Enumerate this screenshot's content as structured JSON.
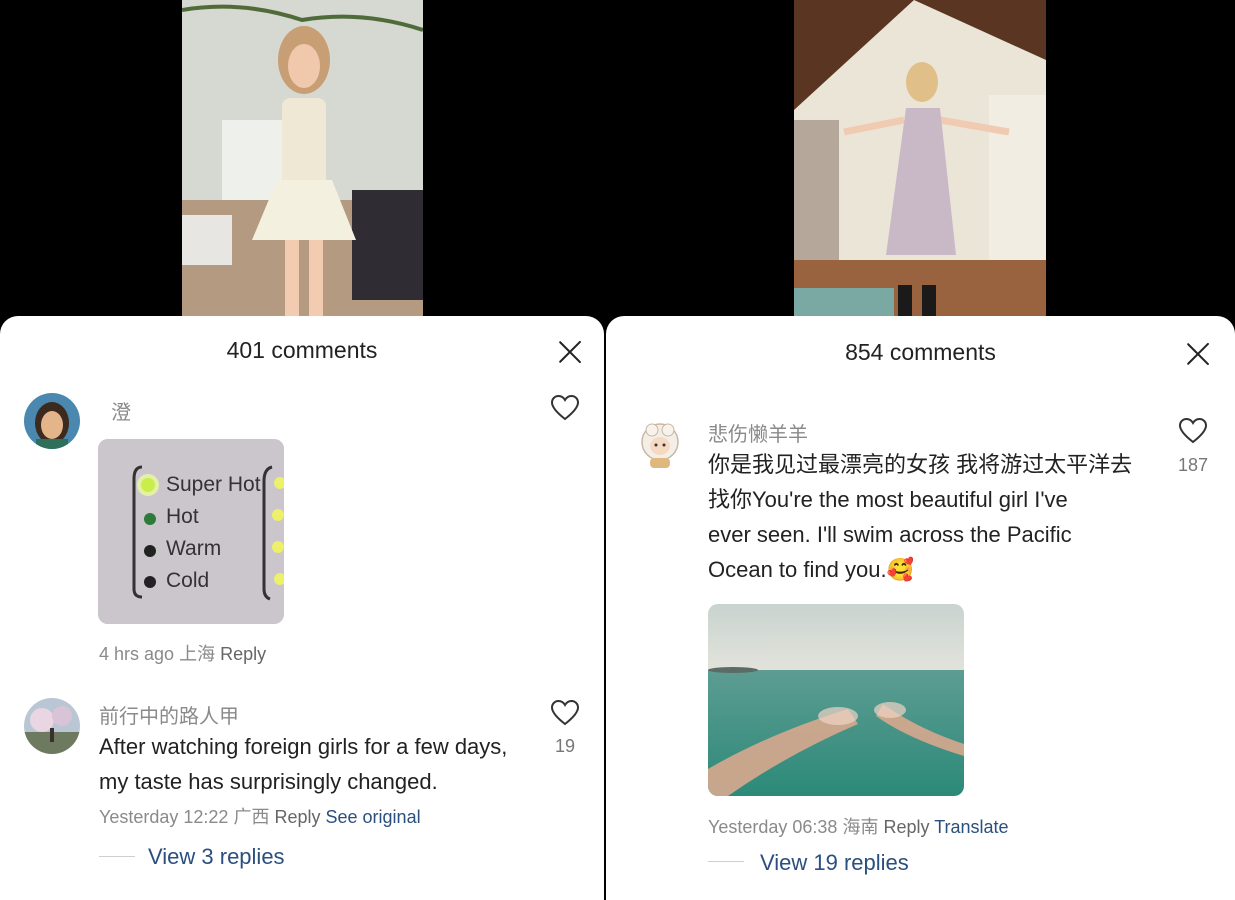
{
  "left": {
    "title": "401 comments",
    "comments": [
      {
        "username": "澄",
        "image_lines": [
          "Super Hot",
          "Hot",
          "Warm",
          "Cold"
        ],
        "time": "4 hrs ago",
        "location": "上海",
        "reply": "Reply"
      },
      {
        "username": "前行中的路人甲",
        "text_line1": "After watching foreign girls for a few days,",
        "text_line2": "my taste has surprisingly changed.",
        "likes": "19",
        "time": "Yesterday 12:22",
        "location": "广西",
        "reply": "Reply",
        "extra_link": "See original",
        "view_replies": "View 3 replies"
      }
    ]
  },
  "right": {
    "title": "854 comments",
    "comment": {
      "username": "悲伤懒羊羊",
      "line1": "你是我见过最漂亮的女孩 我将游过太平洋去",
      "line2": "找你You're the most beautiful  girl   I've",
      "line3": "ever seen. I'll swim across the Pacific",
      "line4": "Ocean to find you.",
      "emoji": "🥰",
      "likes": "187",
      "time": "Yesterday 06:38",
      "location": "海南",
      "reply": "Reply",
      "extra_link": "Translate",
      "view_replies": "View 19 replies"
    }
  },
  "colors": {
    "link": "#2b4f7e",
    "meta": "#8a8a8a",
    "background": "#000000",
    "sheet": "#ffffff"
  },
  "icons": [
    "close-icon",
    "heart-icon"
  ]
}
